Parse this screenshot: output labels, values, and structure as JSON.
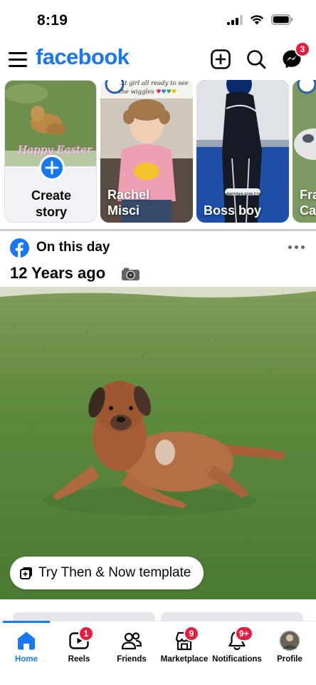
{
  "status_bar": {
    "time": "8:19"
  },
  "header": {
    "brand": "facebook",
    "messenger_badge": "3"
  },
  "stories": {
    "create": {
      "label_line1": "Create",
      "label_line2": "story",
      "image_text": "Happy Easter"
    },
    "items": [
      {
        "name_line1": "Rachel",
        "name_line2": "Misci",
        "caption_line1": "...t girl all ready to see",
        "caption_line2": "the wiggles"
      },
      {
        "name_line1": "Boss boy",
        "name_line2": "",
        "watermark": "BRITISHLEON.COM"
      },
      {
        "name_line1": "Fra",
        "name_line2": "Ca"
      }
    ]
  },
  "memory": {
    "section_title": "On this day",
    "years_ago": "12 Years ago",
    "template_button": "Try Then & Now template"
  },
  "tabs": [
    {
      "label": "Home",
      "icon": "home-icon",
      "badge": ""
    },
    {
      "label": "Reels",
      "icon": "reels-icon",
      "badge": "1"
    },
    {
      "label": "Friends",
      "icon": "friends-icon",
      "badge": ""
    },
    {
      "label": "Marketplace",
      "icon": "marketplace-icon",
      "badge": "9"
    },
    {
      "label": "Notifications",
      "icon": "bell-icon",
      "badge": "9+"
    },
    {
      "label": "Profile",
      "icon": "profile-avatar",
      "badge": ""
    }
  ],
  "colors": {
    "brand_blue": "#1877F2",
    "badge_red": "#E41E3F",
    "text": "#050505",
    "muted": "#65676B"
  }
}
